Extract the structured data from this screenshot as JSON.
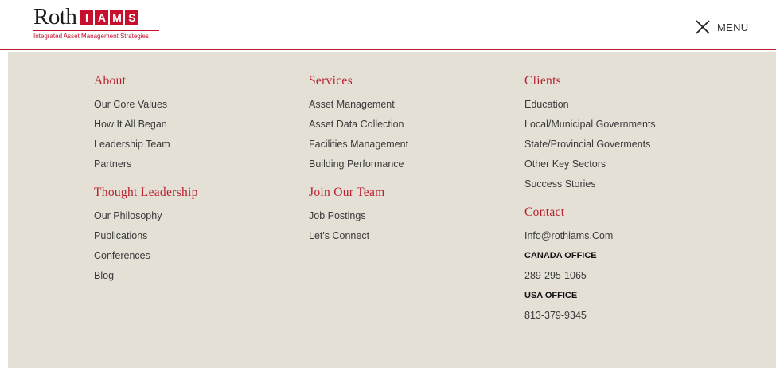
{
  "header": {
    "logo": {
      "wordmark": "Roth",
      "letters": [
        "I",
        "A",
        "M",
        "S"
      ],
      "tagline": "Integrated Asset Management Strategies"
    },
    "menu_label": "MENU",
    "menu_icon": "close-x-icon"
  },
  "colors": {
    "brand_red": "#b71f2e",
    "panel_bg": "#e4e0d6"
  },
  "nav": {
    "about": {
      "title": "About",
      "items": [
        "Our Core Values",
        "How It All Began",
        "Leadership Team",
        "Partners"
      ]
    },
    "thought": {
      "title": "Thought Leadership",
      "items": [
        "Our Philosophy",
        "Publications",
        "Conferences",
        "Blog"
      ]
    },
    "services": {
      "title": "Services",
      "items": [
        "Asset Management",
        "Asset Data Collection",
        "Facilities Management",
        "Building Performance"
      ]
    },
    "join": {
      "title": "Join Our Team",
      "items": [
        "Job Postings",
        "Let's Connect"
      ]
    },
    "clients": {
      "title": "Clients",
      "items": [
        "Education",
        "Local/Municipal Governments",
        "State/Provincial Goverments",
        "Other Key Sectors",
        "Success Stories"
      ]
    },
    "contact": {
      "title": "Contact",
      "email": "Info@rothiams.Com",
      "canada_label": "CANADA OFFICE",
      "canada_phone": "289-295-1065",
      "usa_label": "USA OFFICE",
      "usa_phone": "813-379-9345"
    }
  }
}
